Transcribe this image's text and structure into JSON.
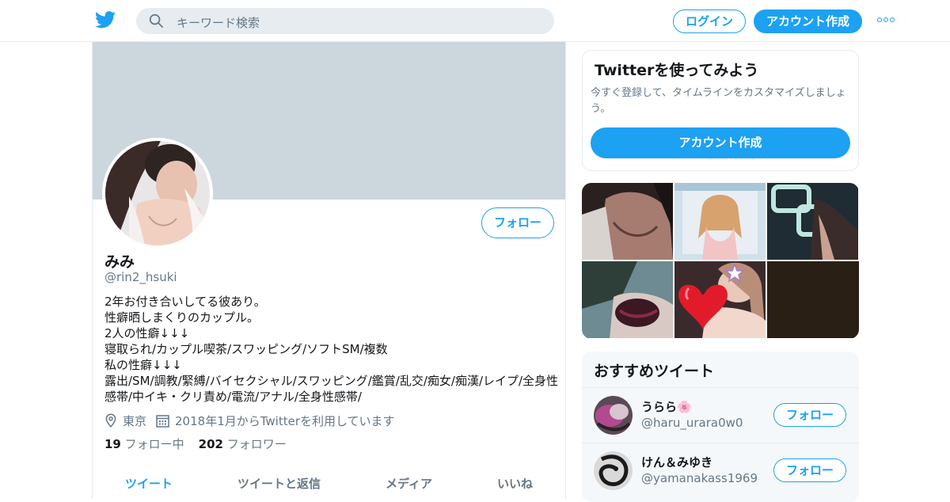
{
  "header": {
    "search_placeholder": "キーワード検索",
    "login_label": "ログイン",
    "signup_label": "アカウント作成",
    "icons": [
      "twitter-bird-icon",
      "search-icon",
      "more-icon"
    ]
  },
  "profile": {
    "follow_label": "フォロー",
    "name": "みみ",
    "handle": "@rin2_hsuki",
    "bio_lines": [
      "2年お付き合いしてる彼あり。",
      "性癖晒しまくりのカップル。",
      "2人の性癖↓↓↓",
      "寝取られ/カップル喫茶/スワッピング/ソフトSM/複数",
      "私の性癖↓↓↓",
      "露出/SM/調教/緊縛/バイセクシャル/スワッピング/鑑賞/乱交/痴女/痴漢/レイプ/全身性",
      "感帯/中イキ・クリ責め/電流/アナル/全身性感帯/"
    ],
    "location": "東京",
    "joined": "2018年1月からTwitterを利用しています",
    "following_count": "19",
    "following_label": "フォロー中",
    "followers_count": "202",
    "followers_label": "フォロワー",
    "tabs": [
      "ツイート",
      "ツイートと返信",
      "メディア",
      "いいね"
    ],
    "active_tab": "ツイート"
  },
  "signup_card": {
    "title": "Twitterを使ってみよう",
    "description": "今すぐ登録して、タイムラインをカスタマイズしましょう。",
    "button_label": "アカウント作成"
  },
  "recommended": {
    "title": "おすすめツイート",
    "users": [
      {
        "name": "うらら🌸",
        "handle": "@haru_urara0w0",
        "follow_label": "フォロー"
      },
      {
        "name": "けん＆みゆき",
        "handle": "@yamanakass1969",
        "follow_label": "フォロー"
      }
    ]
  },
  "colors": {
    "accent": "#1da1f2",
    "secondary_text": "#657786",
    "border": "#e6ecf0",
    "banner": "#ccd6dd"
  }
}
